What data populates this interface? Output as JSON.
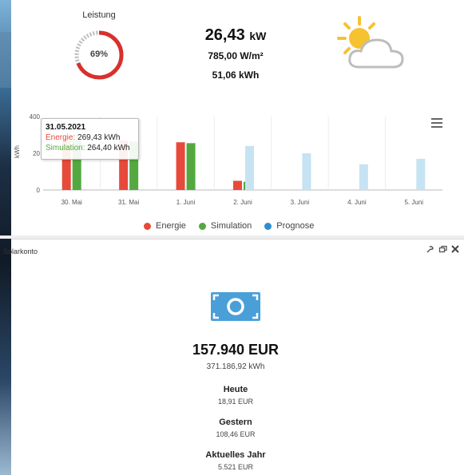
{
  "gauge": {
    "label": "Leistung",
    "value_text": "69%",
    "percent": 0.69,
    "color": "#d9302c"
  },
  "current": {
    "power_value": "26,43",
    "power_unit": "kW",
    "irradiance": "785,00 W/m²",
    "energy": "51,06 kWh"
  },
  "weather": {
    "icon": "partly-sunny-icon"
  },
  "chart_data": {
    "type": "bar",
    "ylabel": "kWh",
    "yticks": [
      "0",
      "20",
      "400"
    ],
    "ylim": [
      0,
      40
    ],
    "categories": [
      "30. Mai",
      "31. Mai",
      "1. Juni",
      "2. Juni",
      "3. Juni",
      "4. Juni",
      "5. Juni"
    ],
    "series": [
      {
        "name": "Energie",
        "color": "#e74a3b",
        "values": [
          27,
          27,
          26,
          5,
          null,
          null,
          null
        ]
      },
      {
        "name": "Simulation",
        "color": "#53a93f",
        "values": [
          27,
          26.4,
          25.5,
          4.5,
          null,
          null,
          null
        ]
      },
      {
        "name": "Prognose",
        "color": "#c6e3f3",
        "values": [
          null,
          null,
          null,
          24,
          20,
          14,
          17
        ]
      }
    ],
    "legend_position": "bottom"
  },
  "tooltip": {
    "date": "31.05.2021",
    "energie_label": "Energie:",
    "energie_value": "269,43 kWh",
    "simulation_label": "Simulation:",
    "simulation_value": "264,40 kWh"
  },
  "solarkonto": {
    "title": "Solarkonto",
    "total": "157.940 EUR",
    "total_kwh": "371.186,92 kWh",
    "heute_label": "Heute",
    "heute_value": "18,91 EUR",
    "gestern_label": "Gestern",
    "gestern_value": "108,46 EUR",
    "jahr_label": "Aktuelles Jahr",
    "jahr_value": "5.521 EUR",
    "icon": "money-icon",
    "accent": "#4a9fd8"
  }
}
